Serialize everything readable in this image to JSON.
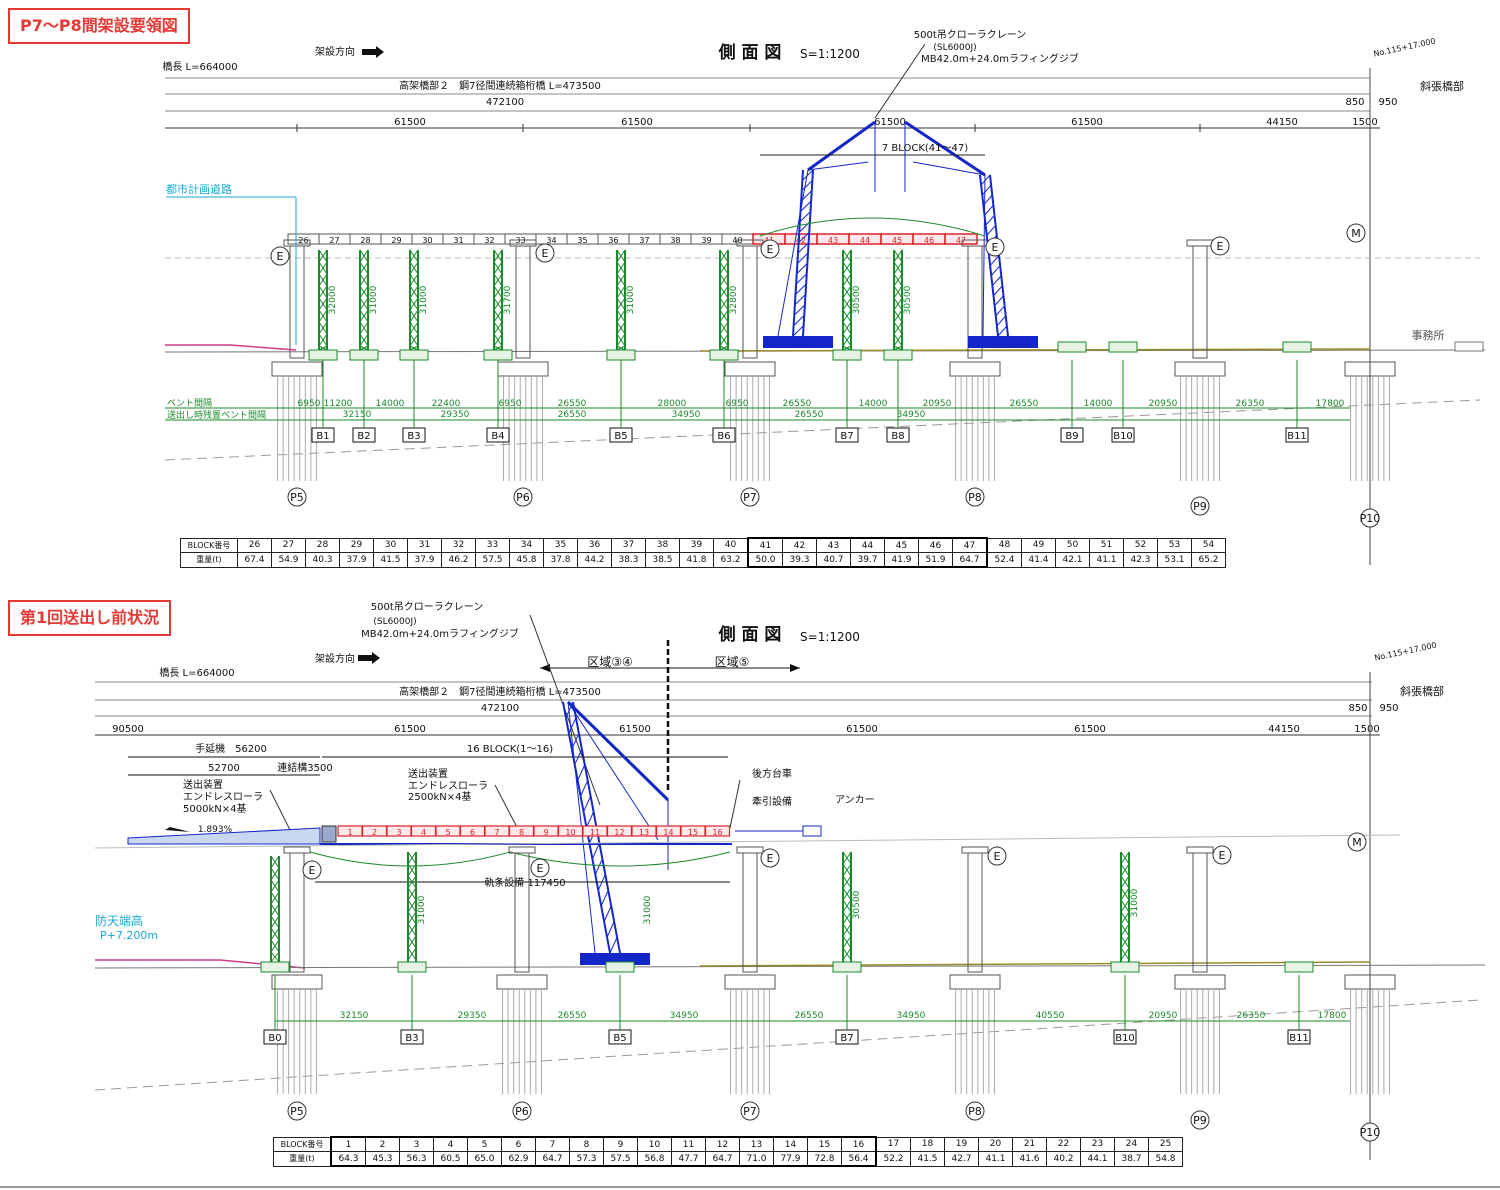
{
  "panels": [
    {
      "heading": "P7〜P8間架設要領図",
      "view_title": "側 面 図",
      "scale": "S=1:1200",
      "erection_direction": "架設方向",
      "bridge_length": "橋長 L=664000",
      "girder": "高架橋部２　鋼7径間連続箱桁橋 L=473500",
      "overall_dim": "472100",
      "right_dims": [
        "850",
        "950"
      ],
      "station": "No.115+17.000",
      "cable_stayed": "斜張橋部",
      "span_labels": [
        "61500",
        "61500",
        "61500",
        "61500",
        "44150",
        "1500"
      ],
      "crane": [
        "500t吊クローラクレーン",
        "(SL6000J)",
        "MB42.0m+24.0mラフィングジブ"
      ],
      "erection_block": "7 BLOCK(41〜47)",
      "city_road": "都市計画道路",
      "office": "事務所",
      "bent_spacing_labels": [
        "ベント間隔",
        "送出し時残置ベント間隔"
      ],
      "bent_heights": [
        "32000",
        "31000",
        "31000",
        "31700",
        "31000",
        "32800",
        "30500",
        "30500"
      ],
      "bent_dims_row1": [
        "6950",
        "11200",
        "14000",
        "22400",
        "6950",
        "26550",
        "28000",
        "6950",
        "26550",
        "14000",
        "20950",
        "26550",
        "14000",
        "20950",
        "26350",
        "17800"
      ],
      "bent_dims_row2": [
        "32150",
        "29350",
        "26550",
        "34950",
        "26550",
        "34950"
      ],
      "bents": [
        "B1",
        "B2",
        "B3",
        "B4",
        "B5",
        "B6",
        "B7",
        "B8",
        "B9",
        "B10",
        "B11"
      ],
      "piers": [
        "P5",
        "P6",
        "P7",
        "P8",
        "P9",
        "P10"
      ],
      "deck_blocks": [
        "26",
        "27",
        "28",
        "29",
        "30",
        "31",
        "32",
        "33",
        "34",
        "35",
        "36",
        "37",
        "38",
        "39",
        "40",
        "41",
        "42",
        "43",
        "44",
        "45",
        "46",
        "47"
      ],
      "block_table": {
        "row_labels": [
          "BLOCK番号",
          "重量(t)"
        ],
        "numbers": [
          "26",
          "27",
          "28",
          "29",
          "30",
          "31",
          "32",
          "33",
          "34",
          "35",
          "36",
          "37",
          "38",
          "39",
          "40",
          "41",
          "42",
          "43",
          "44",
          "45",
          "46",
          "47",
          "48",
          "49",
          "50",
          "51",
          "52",
          "53",
          "54"
        ],
        "weights": [
          "67.4",
          "54.9",
          "40.3",
          "37.9",
          "41.5",
          "37.9",
          "46.2",
          "57.5",
          "45.8",
          "37.8",
          "44.2",
          "38.3",
          "38.5",
          "41.8",
          "63.2",
          "50.0",
          "39.3",
          "40.7",
          "39.7",
          "41.9",
          "51.9",
          "64.7",
          "52.4",
          "41.4",
          "42.1",
          "41.1",
          "42.3",
          "53.1",
          "65.2"
        ]
      }
    },
    {
      "heading": "第1回送出し前状況",
      "view_title": "側 面 図",
      "scale": "S=1:1200",
      "erection_direction": "架設方向",
      "bridge_length": "橋長 L=664000",
      "girder": "高架橋部２　鋼7径間連続箱桁橋 L=473500",
      "overall_dim": "472100",
      "right_dims": [
        "850",
        "950"
      ],
      "station": "No.115+17.000",
      "cable_stayed": "斜張橋部",
      "left_span": "90500",
      "span_labels": [
        "61500",
        "61500",
        "61500",
        "61500",
        "44150",
        "1500"
      ],
      "crane": [
        "500t吊クローラクレーン",
        "(SL6000J)",
        "MB42.0m+24.0mラフィングジブ"
      ],
      "zones": [
        "区域③④",
        "区域⑤"
      ],
      "launch_nose": "手延機　56200",
      "dim_52700": "52700",
      "link_girder": "連結構3500",
      "launch_block": "16 BLOCK(1〜16)",
      "launcher_left": [
        "送出装置",
        "エンドレスローラ",
        "5000kN×4基"
      ],
      "launcher_mid": [
        "送出装置",
        "エンドレスローラ",
        "2500kN×4基"
      ],
      "rear_bogie": "後方台車",
      "traction": "牽引設備",
      "anchor": "アンカー",
      "gradient": "1.893%",
      "rail": "軌条設備 117450",
      "wave_height": [
        "防天端高",
        "P+7.200m"
      ],
      "bent_heights": [
        "31000",
        "31000",
        "30500",
        "31000"
      ],
      "bent_dims": [
        "32150",
        "29350",
        "26550",
        "34950",
        "26550",
        "34950",
        "40550",
        "20950",
        "26350",
        "17800"
      ],
      "bents": [
        "B0",
        "B3",
        "B5",
        "B7",
        "B10",
        "B11"
      ],
      "piers": [
        "P5",
        "P6",
        "P7",
        "P8",
        "P9",
        "P10"
      ],
      "deck_blocks": [
        "1",
        "2",
        "3",
        "4",
        "5",
        "6",
        "7",
        "8",
        "9",
        "10",
        "11",
        "12",
        "13",
        "14",
        "15",
        "16"
      ],
      "block_table": {
        "row_labels": [
          "BLOCK番号",
          "重量(t)"
        ],
        "numbers": [
          "1",
          "2",
          "3",
          "4",
          "5",
          "6",
          "7",
          "8",
          "9",
          "10",
          "11",
          "12",
          "13",
          "14",
          "15",
          "16",
          "17",
          "18",
          "19",
          "20",
          "21",
          "22",
          "23",
          "24",
          "25"
        ],
        "weights": [
          "64.3",
          "45.3",
          "56.3",
          "60.5",
          "65.0",
          "62.9",
          "64.7",
          "57.3",
          "57.5",
          "56.8",
          "47.7",
          "64.7",
          "71.0",
          "77.9",
          "72.8",
          "56.4",
          "52.2",
          "41.5",
          "42.7",
          "41.1",
          "41.6",
          "40.2",
          "44.1",
          "38.7",
          "54.8"
        ]
      }
    }
  ]
}
